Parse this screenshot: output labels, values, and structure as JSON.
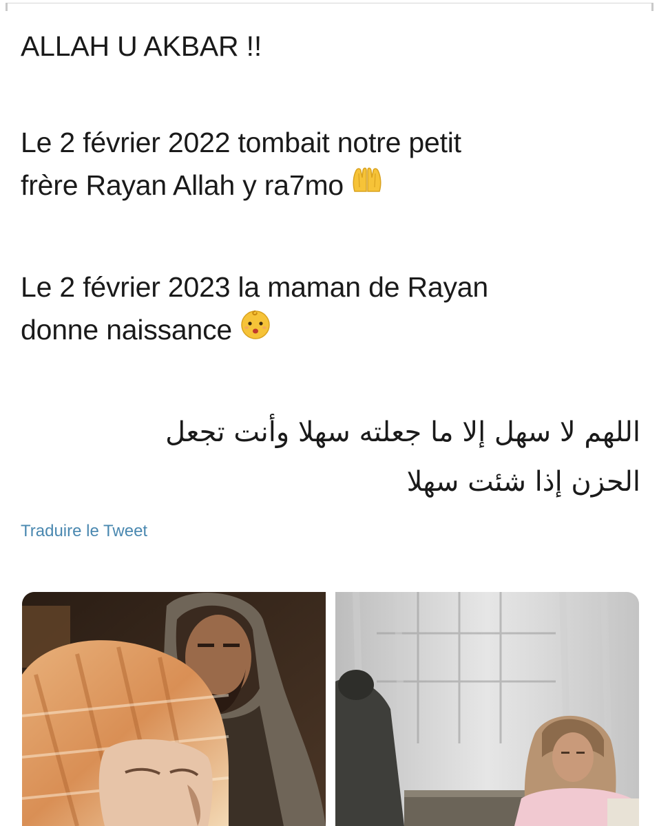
{
  "tweet": {
    "line_1": "ALLAH U AKBAR !!",
    "para_2_line_1": "Le 2 février 2022 tombait notre petit",
    "para_2_line_2": "frère Rayan Allah y ra7mo",
    "para_3_line_1": "Le 2 février 2023 la maman de Rayan",
    "para_3_line_2": "donne naissance",
    "arabic_line_1": "اللهم لا سهل إلا ما جعلته سهلا وأنت تجعل",
    "arabic_line_2": "الحزن إذا شئت سهلا",
    "icons": {
      "praying_hands": "praying-hands-icon",
      "baby_face": "baby-face-icon"
    }
  },
  "translate_link": "Traduire le Tweet",
  "media": {
    "images": [
      {
        "name": "photo-parents-night"
      },
      {
        "name": "photo-mother-room"
      }
    ]
  },
  "colors": {
    "text": "#1a1a1a",
    "link": "#4a88b0",
    "emoji_yellow": "#f6c338"
  }
}
